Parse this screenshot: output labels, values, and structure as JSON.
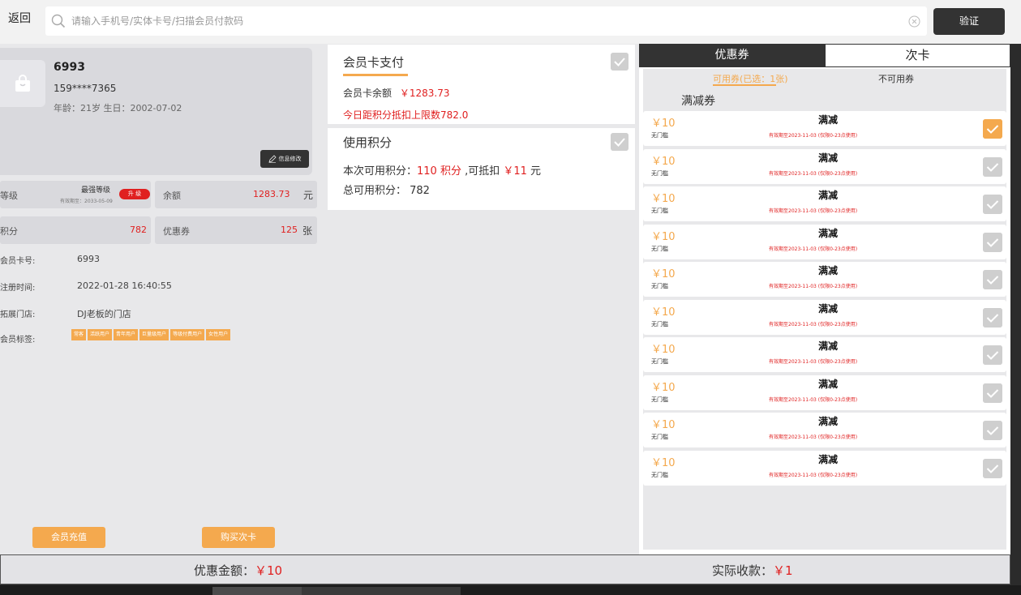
{
  "topbar": {
    "back_label": "返回",
    "search_placeholder": "请输入手机号/实体卡号/扫描会员付款码",
    "search_value": "",
    "verify_label": "验证"
  },
  "member": {
    "name": "6993",
    "phone": "159****7365",
    "age_birthday": "年龄：21岁  生日：2002-07-02",
    "edit_label": "信息修改",
    "level_label": "等级",
    "level_name": "最强等级",
    "level_expiry": "有效期至：2033-05-09",
    "upgrade_label": "升 级",
    "balance_label": "余额",
    "balance_value": "1283.73",
    "balance_unit": "元",
    "points_label": "积分",
    "points_value": "782",
    "coupons_label": "优惠券",
    "coupons_value": "125",
    "coupons_unit": "张",
    "details": [
      {
        "label": "会员卡号:",
        "value": "6993"
      },
      {
        "label": "注册时间:",
        "value": "2022-01-28 16:40:55"
      },
      {
        "label": "拓展门店:",
        "value": "DJ老板的门店"
      }
    ],
    "tags_label": "会员标签:",
    "tags": [
      "常客",
      "活跃用户",
      "青年用户",
      "巨量级用户",
      "等级付费用户",
      "女性用户"
    ],
    "recharge_label": "会员充值",
    "buy_card_label": "购买次卡"
  },
  "card_pay": {
    "title": "会员卡支付",
    "balance_label": "会员卡余额",
    "balance_value": "￥1283.73",
    "limit_text": "今日距积分抵扣上限数782.0"
  },
  "points_pay": {
    "title": "使用积分",
    "line1_prefix": "本次可用积分：",
    "line1_points": "110 积分",
    "line1_mid": " ,可抵扣 ",
    "line1_amount": "￥11",
    "line1_suffix": " 元",
    "line2": "总可用积分：  782"
  },
  "right": {
    "tab_coupon": "优惠券",
    "tab_card": "次卡",
    "subtab_usable": "可用券(已选：1张)",
    "subtab_unusable": "不可用券",
    "section_title": "满减券",
    "coupons": [
      {
        "amount": "￥10",
        "threshold": "无门槛",
        "title": "满减",
        "validity": "有效期至2023-11-03 (仅限0-23点使用)",
        "checked": true
      },
      {
        "amount": "￥10",
        "threshold": "无门槛",
        "title": "满减",
        "validity": "有效期至2023-11-03 (仅限0-23点使用)",
        "checked": false
      },
      {
        "amount": "￥10",
        "threshold": "无门槛",
        "title": "满减",
        "validity": "有效期至2023-11-03 (仅限0-23点使用)",
        "checked": false
      },
      {
        "amount": "￥10",
        "threshold": "无门槛",
        "title": "满减",
        "validity": "有效期至2023-11-03 (仅限0-23点使用)",
        "checked": false
      },
      {
        "amount": "￥10",
        "threshold": "无门槛",
        "title": "满减",
        "validity": "有效期至2023-11-03 (仅限0-23点使用)",
        "checked": false
      },
      {
        "amount": "￥10",
        "threshold": "无门槛",
        "title": "满减",
        "validity": "有效期至2023-11-03 (仅限0-23点使用)",
        "checked": false
      },
      {
        "amount": "￥10",
        "threshold": "无门槛",
        "title": "满减",
        "validity": "有效期至2023-11-03 (仅限0-23点使用)",
        "checked": false
      },
      {
        "amount": "￥10",
        "threshold": "无门槛",
        "title": "满减",
        "validity": "有效期至2023-11-03 (仅限0-23点使用)",
        "checked": false
      },
      {
        "amount": "￥10",
        "threshold": "无门槛",
        "title": "满减",
        "validity": "有效期至2023-11-03 (仅限0-23点使用)",
        "checked": false
      },
      {
        "amount": "￥10",
        "threshold": "无门槛",
        "title": "满减",
        "validity": "有效期至2023-11-03 (仅限0-23点使用)",
        "checked": false
      }
    ]
  },
  "footer": {
    "discount_label": "优惠金额：",
    "discount_value": "￥10",
    "actual_label": "实际收款：",
    "actual_value": "￥1"
  },
  "colors": {
    "accent": "#f4a94e",
    "price_red": "#e02020",
    "dark": "#333333"
  }
}
